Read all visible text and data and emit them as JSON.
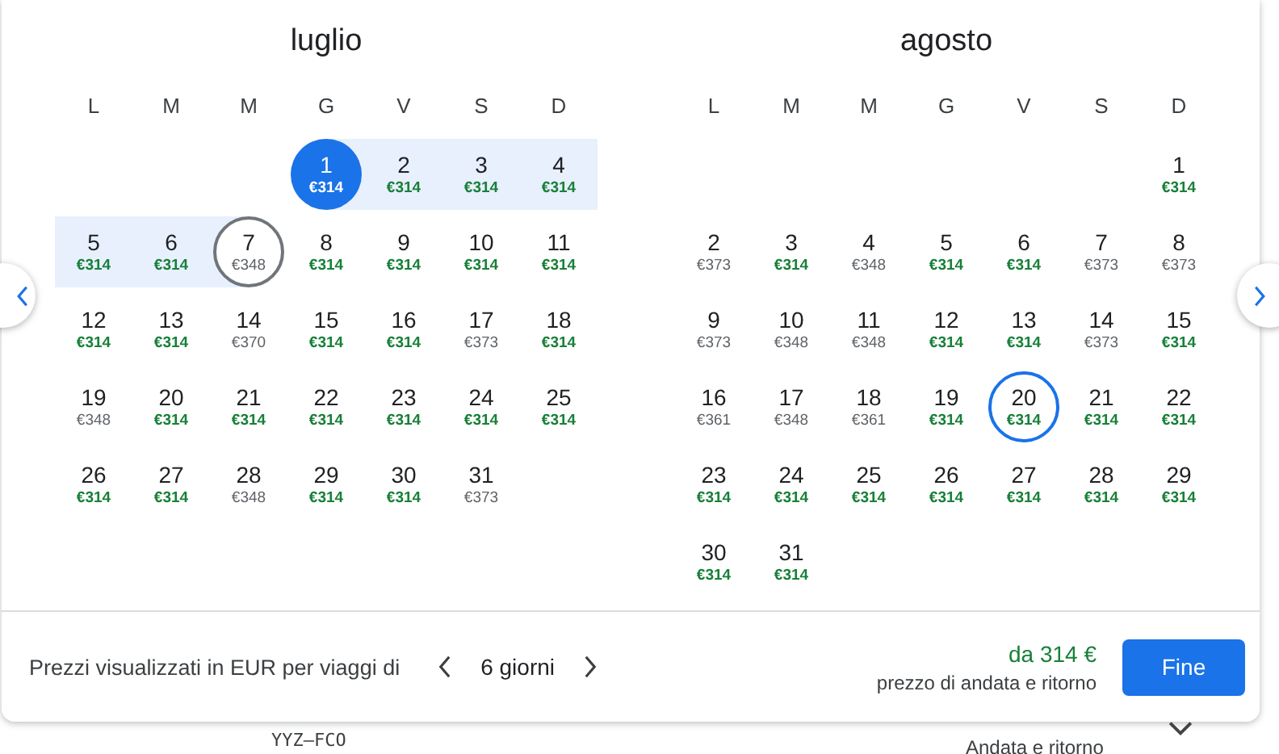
{
  "months": [
    {
      "name": "luglio",
      "weekdays": [
        "L",
        "M",
        "M",
        "G",
        "V",
        "S",
        "D"
      ],
      "weeks": [
        [
          {
            "day": "1",
            "price": "€314",
            "cheap": true,
            "selected": true,
            "in_range": false,
            "hovered": false,
            "return_date": false
          },
          {
            "day": "2",
            "price": "€314",
            "cheap": true,
            "selected": false,
            "in_range": true,
            "hovered": false,
            "return_date": false
          },
          {
            "day": "3",
            "price": "€314",
            "cheap": true,
            "selected": false,
            "in_range": true,
            "hovered": false,
            "return_date": false
          },
          {
            "day": "4",
            "price": "€314",
            "cheap": true,
            "selected": false,
            "in_range": true,
            "hovered": false,
            "return_date": false
          }
        ],
        [
          {
            "day": "5",
            "price": "€314",
            "cheap": true,
            "selected": false,
            "in_range": true,
            "hovered": false,
            "return_date": false
          },
          {
            "day": "6",
            "price": "€314",
            "cheap": true,
            "selected": false,
            "in_range": true,
            "hovered": false,
            "return_date": false
          },
          {
            "day": "7",
            "price": "€348",
            "cheap": false,
            "selected": false,
            "in_range": false,
            "hovered": true,
            "return_date": false
          },
          {
            "day": "8",
            "price": "€314",
            "cheap": true,
            "selected": false,
            "in_range": false,
            "hovered": false,
            "return_date": false
          },
          {
            "day": "9",
            "price": "€314",
            "cheap": true,
            "selected": false,
            "in_range": false,
            "hovered": false,
            "return_date": false
          },
          {
            "day": "10",
            "price": "€314",
            "cheap": true,
            "selected": false,
            "in_range": false,
            "hovered": false,
            "return_date": false
          },
          {
            "day": "11",
            "price": "€314",
            "cheap": true,
            "selected": false,
            "in_range": false,
            "hovered": false,
            "return_date": false
          }
        ],
        [
          {
            "day": "12",
            "price": "€314",
            "cheap": true,
            "selected": false,
            "in_range": false,
            "hovered": false,
            "return_date": false
          },
          {
            "day": "13",
            "price": "€314",
            "cheap": true,
            "selected": false,
            "in_range": false,
            "hovered": false,
            "return_date": false
          },
          {
            "day": "14",
            "price": "€370",
            "cheap": false,
            "selected": false,
            "in_range": false,
            "hovered": false,
            "return_date": false
          },
          {
            "day": "15",
            "price": "€314",
            "cheap": true,
            "selected": false,
            "in_range": false,
            "hovered": false,
            "return_date": false
          },
          {
            "day": "16",
            "price": "€314",
            "cheap": true,
            "selected": false,
            "in_range": false,
            "hovered": false,
            "return_date": false
          },
          {
            "day": "17",
            "price": "€373",
            "cheap": false,
            "selected": false,
            "in_range": false,
            "hovered": false,
            "return_date": false
          },
          {
            "day": "18",
            "price": "€314",
            "cheap": true,
            "selected": false,
            "in_range": false,
            "hovered": false,
            "return_date": false
          }
        ],
        [
          {
            "day": "19",
            "price": "€348",
            "cheap": false,
            "selected": false,
            "in_range": false,
            "hovered": false,
            "return_date": false
          },
          {
            "day": "20",
            "price": "€314",
            "cheap": true,
            "selected": false,
            "in_range": false,
            "hovered": false,
            "return_date": false
          },
          {
            "day": "21",
            "price": "€314",
            "cheap": true,
            "selected": false,
            "in_range": false,
            "hovered": false,
            "return_date": false
          },
          {
            "day": "22",
            "price": "€314",
            "cheap": true,
            "selected": false,
            "in_range": false,
            "hovered": false,
            "return_date": false
          },
          {
            "day": "23",
            "price": "€314",
            "cheap": true,
            "selected": false,
            "in_range": false,
            "hovered": false,
            "return_date": false
          },
          {
            "day": "24",
            "price": "€314",
            "cheap": true,
            "selected": false,
            "in_range": false,
            "hovered": false,
            "return_date": false
          },
          {
            "day": "25",
            "price": "€314",
            "cheap": true,
            "selected": false,
            "in_range": false,
            "hovered": false,
            "return_date": false
          }
        ],
        [
          {
            "day": "26",
            "price": "€314",
            "cheap": true,
            "selected": false,
            "in_range": false,
            "hovered": false,
            "return_date": false
          },
          {
            "day": "27",
            "price": "€314",
            "cheap": true,
            "selected": false,
            "in_range": false,
            "hovered": false,
            "return_date": false
          },
          {
            "day": "28",
            "price": "€348",
            "cheap": false,
            "selected": false,
            "in_range": false,
            "hovered": false,
            "return_date": false
          },
          {
            "day": "29",
            "price": "€314",
            "cheap": true,
            "selected": false,
            "in_range": false,
            "hovered": false,
            "return_date": false
          },
          {
            "day": "30",
            "price": "€314",
            "cheap": true,
            "selected": false,
            "in_range": false,
            "hovered": false,
            "return_date": false
          },
          {
            "day": "31",
            "price": "€373",
            "cheap": false,
            "selected": false,
            "in_range": false,
            "hovered": false,
            "return_date": false
          }
        ]
      ]
    },
    {
      "name": "agosto",
      "weekdays": [
        "L",
        "M",
        "M",
        "G",
        "V",
        "S",
        "D"
      ],
      "weeks": [
        [
          {
            "day": "1",
            "price": "€314",
            "cheap": true,
            "selected": false,
            "in_range": false,
            "hovered": false,
            "return_date": false
          }
        ],
        [
          {
            "day": "2",
            "price": "€373",
            "cheap": false,
            "selected": false,
            "in_range": false,
            "hovered": false,
            "return_date": false
          },
          {
            "day": "3",
            "price": "€314",
            "cheap": true,
            "selected": false,
            "in_range": false,
            "hovered": false,
            "return_date": false
          },
          {
            "day": "4",
            "price": "€348",
            "cheap": false,
            "selected": false,
            "in_range": false,
            "hovered": false,
            "return_date": false
          },
          {
            "day": "5",
            "price": "€314",
            "cheap": true,
            "selected": false,
            "in_range": false,
            "hovered": false,
            "return_date": false
          },
          {
            "day": "6",
            "price": "€314",
            "cheap": true,
            "selected": false,
            "in_range": false,
            "hovered": false,
            "return_date": false
          },
          {
            "day": "7",
            "price": "€373",
            "cheap": false,
            "selected": false,
            "in_range": false,
            "hovered": false,
            "return_date": false
          },
          {
            "day": "8",
            "price": "€373",
            "cheap": false,
            "selected": false,
            "in_range": false,
            "hovered": false,
            "return_date": false
          }
        ],
        [
          {
            "day": "9",
            "price": "€373",
            "cheap": false,
            "selected": false,
            "in_range": false,
            "hovered": false,
            "return_date": false
          },
          {
            "day": "10",
            "price": "€348",
            "cheap": false,
            "selected": false,
            "in_range": false,
            "hovered": false,
            "return_date": false
          },
          {
            "day": "11",
            "price": "€348",
            "cheap": false,
            "selected": false,
            "in_range": false,
            "hovered": false,
            "return_date": false
          },
          {
            "day": "12",
            "price": "€314",
            "cheap": true,
            "selected": false,
            "in_range": false,
            "hovered": false,
            "return_date": false
          },
          {
            "day": "13",
            "price": "€314",
            "cheap": true,
            "selected": false,
            "in_range": false,
            "hovered": false,
            "return_date": false
          },
          {
            "day": "14",
            "price": "€373",
            "cheap": false,
            "selected": false,
            "in_range": false,
            "hovered": false,
            "return_date": false
          },
          {
            "day": "15",
            "price": "€314",
            "cheap": true,
            "selected": false,
            "in_range": false,
            "hovered": false,
            "return_date": false
          }
        ],
        [
          {
            "day": "16",
            "price": "€361",
            "cheap": false,
            "selected": false,
            "in_range": false,
            "hovered": false,
            "return_date": false
          },
          {
            "day": "17",
            "price": "€348",
            "cheap": false,
            "selected": false,
            "in_range": false,
            "hovered": false,
            "return_date": false
          },
          {
            "day": "18",
            "price": "€361",
            "cheap": false,
            "selected": false,
            "in_range": false,
            "hovered": false,
            "return_date": false
          },
          {
            "day": "19",
            "price": "€314",
            "cheap": true,
            "selected": false,
            "in_range": false,
            "hovered": false,
            "return_date": false
          },
          {
            "day": "20",
            "price": "€314",
            "cheap": true,
            "selected": false,
            "in_range": false,
            "hovered": false,
            "return_date": true
          },
          {
            "day": "21",
            "price": "€314",
            "cheap": true,
            "selected": false,
            "in_range": false,
            "hovered": false,
            "return_date": false
          },
          {
            "day": "22",
            "price": "€314",
            "cheap": true,
            "selected": false,
            "in_range": false,
            "hovered": false,
            "return_date": false
          }
        ],
        [
          {
            "day": "23",
            "price": "€314",
            "cheap": true,
            "selected": false,
            "in_range": false,
            "hovered": false,
            "return_date": false
          },
          {
            "day": "24",
            "price": "€314",
            "cheap": true,
            "selected": false,
            "in_range": false,
            "hovered": false,
            "return_date": false
          },
          {
            "day": "25",
            "price": "€314",
            "cheap": true,
            "selected": false,
            "in_range": false,
            "hovered": false,
            "return_date": false
          },
          {
            "day": "26",
            "price": "€314",
            "cheap": true,
            "selected": false,
            "in_range": false,
            "hovered": false,
            "return_date": false
          },
          {
            "day": "27",
            "price": "€314",
            "cheap": true,
            "selected": false,
            "in_range": false,
            "hovered": false,
            "return_date": false
          },
          {
            "day": "28",
            "price": "€314",
            "cheap": true,
            "selected": false,
            "in_range": false,
            "hovered": false,
            "return_date": false
          },
          {
            "day": "29",
            "price": "€314",
            "cheap": true,
            "selected": false,
            "in_range": false,
            "hovered": false,
            "return_date": false
          }
        ],
        [
          {
            "day": "30",
            "price": "€314",
            "cheap": true,
            "selected": false,
            "in_range": false,
            "hovered": false,
            "return_date": false
          },
          {
            "day": "31",
            "price": "€314",
            "cheap": true,
            "selected": false,
            "in_range": false,
            "hovered": false,
            "return_date": false
          }
        ]
      ]
    }
  ],
  "footer": {
    "label": "Prezzi visualizzati in EUR per viaggi di",
    "duration": "6 giorni",
    "price": "da 314 €",
    "price_note": "prezzo di andata e ritorno",
    "button": "Fine"
  },
  "background": {
    "route": "YYZ–FCO",
    "trip_type": "Andata e ritorno"
  }
}
